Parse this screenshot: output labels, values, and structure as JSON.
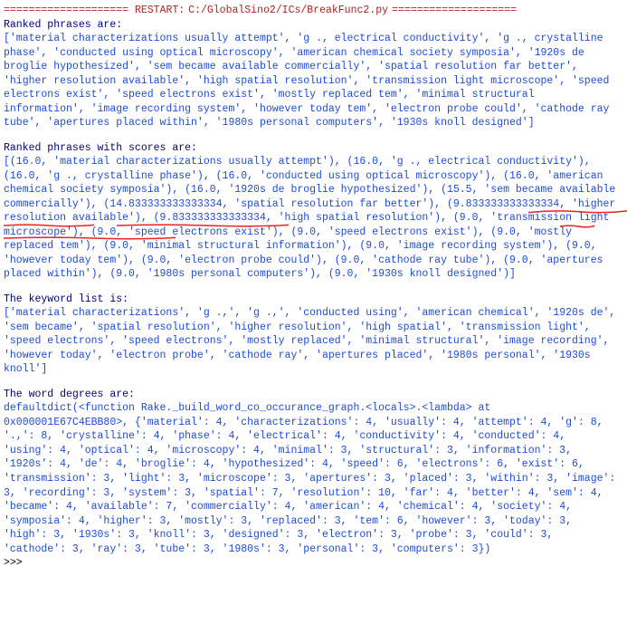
{
  "restart": {
    "left_equals": "====================",
    "label": "RESTART:",
    "path": "C:/GlobalSino2/ICs/BreakFunc2.py",
    "right_equals": "===================="
  },
  "sections": {
    "ranked_phrases_heading": "Ranked phrases are:",
    "ranked_phrases_body": "['material characterizations usually attempt', 'g ., electrical conductivity', 'g ., crystalline phase', 'conducted using optical microscopy', 'american chemical society symposia', '1920s de broglie hypothesized', 'sem became available commercially', 'spatial resolution far better', 'higher resolution available', 'high spatial resolution', 'transmission light microscope', 'speed electrons exist', 'speed electrons exist', 'mostly replaced tem', 'minimal structural information', 'image recording system', 'however today tem', 'electron probe could', 'cathode ray tube', 'apertures placed within', '1980s personal computers', '1930s knoll designed']",
    "ranked_scores_heading": "Ranked phrases with scores are:",
    "ranked_scores_body": "[(16.0, 'material characterizations usually attempt'), (16.0, 'g ., electrical conductivity'), (16.0, 'g ., crystalline phase'), (16.0, 'conducted using optical microscopy'), (16.0, 'american chemical society symposia'), (16.0, '1920s de broglie hypothesized'), (15.5, 'sem became available commercially'), (14.833333333333334, 'spatial resolution far better'), (9.833333333333334, 'higher resolution available'), (9.833333333333334, 'high spatial resolution'), (9.0, 'transmission light microscope'), (9.0, 'speed electrons exist'), (9.0, 'speed electrons exist'), (9.0, 'mostly replaced tem'), (9.0, 'minimal structural information'), (9.0, 'image recording system'), (9.0, 'however today tem'), (9.0, 'electron probe could'), (9.0, 'cathode ray tube'), (9.0, 'apertures placed within'), (9.0, '1980s personal computers'), (9.0, '1930s knoll designed')]",
    "keyword_list_heading": "The keyword list is:",
    "keyword_list_body": "['material characterizations', 'g .,', 'g .,', 'conducted using', 'american chemical', '1920s de', 'sem became', 'spatial resolution', 'higher resolution', 'high spatial', 'transmission light', 'speed electrons', 'speed electrons', 'mostly replaced', 'minimal structural', 'image recording', 'however today', 'electron probe', 'cathode ray', 'apertures placed', '1980s personal', '1930s knoll']",
    "word_degrees_heading": "The word degrees are:",
    "word_degrees_body": "defaultdict(<function Rake._build_word_co_occurance_graph.<locals>.<lambda> at 0x000001E67C4EBB80>, {'material': 4, 'characterizations': 4, 'usually': 4, 'attempt': 4, 'g': 8, '.,': 8, 'crystalline': 4, 'phase': 4, 'electrical': 4, 'conductivity': 4, 'conducted': 4, 'using': 4, 'optical': 4, 'microscopy': 4, 'minimal': 3, 'structural': 3, 'information': 3, '1920s': 4, 'de': 4, 'broglie': 4, 'hypothesized': 4, 'speed': 6, 'electrons': 6, 'exist': 6, 'transmission': 3, 'light': 3, 'microscope': 3, 'apertures': 3, 'placed': 3, 'within': 3, 'image': 3, 'recording': 3, 'system': 3, 'spatial': 7, 'resolution': 10, 'far': 4, 'better': 4, 'sem': 4, 'became': 4, 'available': 7, 'commercially': 4, 'american': 4, 'chemical': 4, 'society': 4, 'symposia': 4, 'higher': 3, 'mostly': 3, 'replaced': 3, 'tem': 6, 'however': 3, 'today': 3, 'high': 3, '1930s': 3, 'knoll': 3, 'designed': 3, 'electron': 3, 'probe': 3, 'could': 3, 'cathode': 3, 'ray': 3, 'tube': 3, '1980s': 3, 'personal': 3, 'computers': 3})"
  },
  "prompt": ">>> "
}
